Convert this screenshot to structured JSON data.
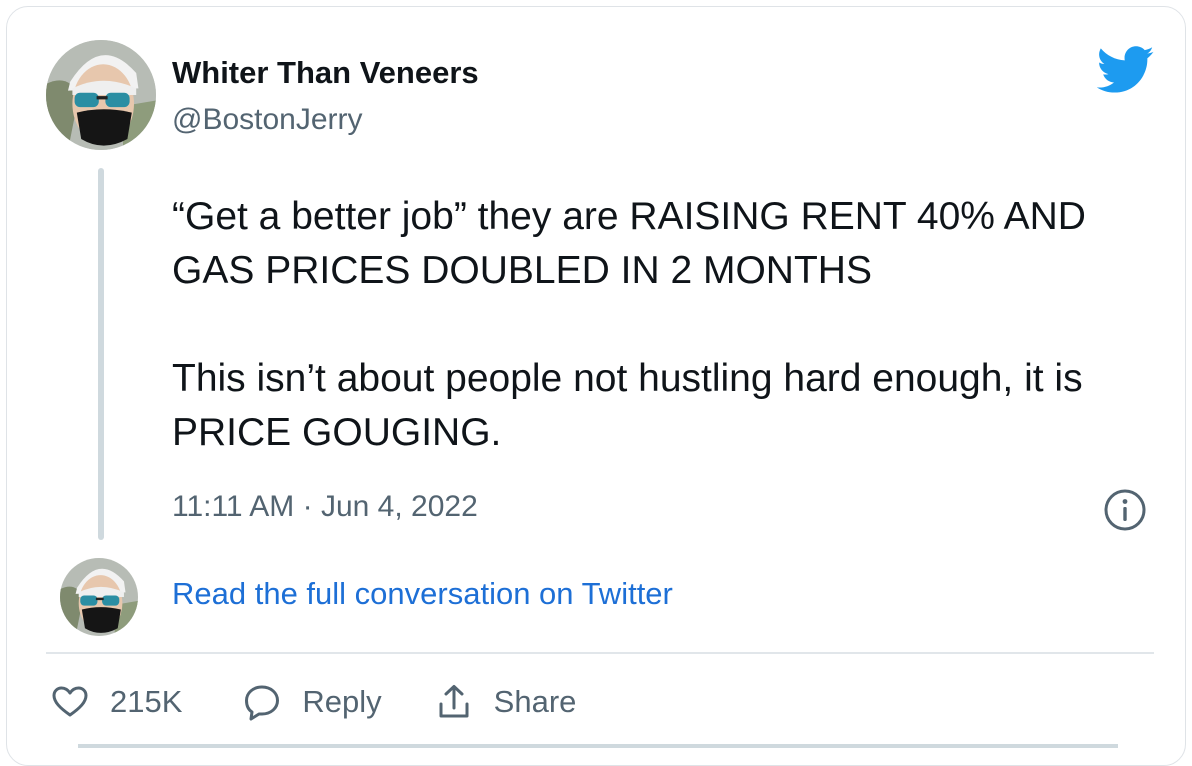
{
  "tweet": {
    "display_name": "Whiter Than Veneers",
    "handle": "@BostonJerry",
    "text_paragraphs": [
      "“Get a better job” they are RAISING RENT 40% AND GAS PRICES DOUBLED IN 2 MONTHS",
      "This isn’t about people not hustling hard enough, it is PRICE GOUGING."
    ],
    "timestamp": "11:11 AM · Jun 4, 2022"
  },
  "conversation": {
    "link_label": "Read the full conversation on Twitter"
  },
  "actions": {
    "like_count": "215K",
    "reply_label": "Reply",
    "share_label": "Share"
  },
  "icons": {
    "brand": "twitter-bird-icon",
    "info": "info-icon",
    "like": "heart-icon",
    "reply": "speech-bubble-icon",
    "share": "share-upload-icon"
  },
  "colors": {
    "brand_blue": "#1d9bf0",
    "link_blue": "#1d6fd6",
    "text_primary": "#0f1419",
    "text_secondary": "#536471"
  }
}
